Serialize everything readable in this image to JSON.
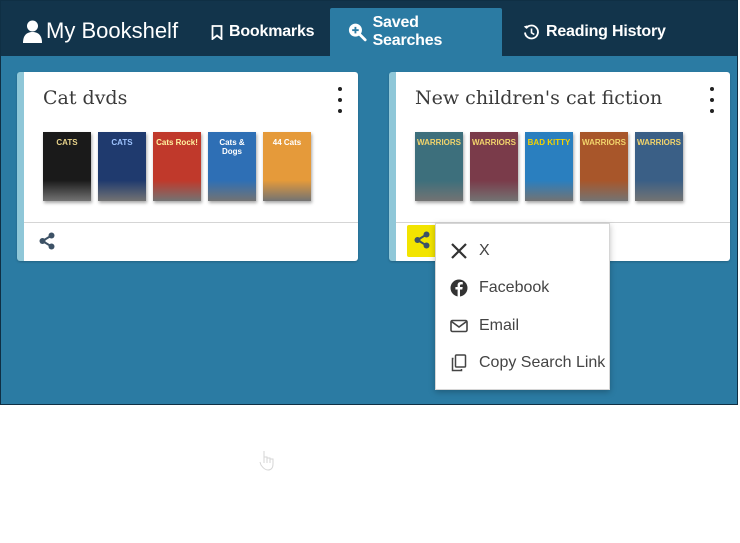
{
  "brand": {
    "title": "My Bookshelf",
    "icon": "user-icon"
  },
  "tabs": [
    {
      "label": "Bookmarks",
      "icon": "bookmark-icon",
      "active": false
    },
    {
      "label": "Saved Searches",
      "icon": "search-plus-icon",
      "active": true
    },
    {
      "label": "Reading History",
      "icon": "history-icon",
      "active": false
    }
  ],
  "cards": [
    {
      "title": "Cat dvds",
      "covers": [
        {
          "text": "CATS",
          "bg": "#1a1a1a",
          "fg": "#e8d38a"
        },
        {
          "text": "CATS",
          "bg": "#1f3a6e",
          "fg": "#9fc4ff"
        },
        {
          "text": "Cats Rock!",
          "bg": "#c0392b",
          "fg": "#fff3a0"
        },
        {
          "text": "Cats & Dogs",
          "bg": "#2e6fb5",
          "fg": "#ffffff"
        },
        {
          "text": "44 Cats",
          "bg": "#e59a3a",
          "fg": "#ffffff"
        }
      ]
    },
    {
      "title": "New children's cat fiction",
      "covers": [
        {
          "text": "WARRIORS",
          "bg": "#3d6f7c",
          "fg": "#f2d46b"
        },
        {
          "text": "WARRIORS",
          "bg": "#7a3b4a",
          "fg": "#f2d46b"
        },
        {
          "text": "BAD KITTY",
          "bg": "#2a7fbf",
          "fg": "#f5d300"
        },
        {
          "text": "WARRIORS",
          "bg": "#a8562a",
          "fg": "#f2d46b"
        },
        {
          "text": "WARRIORS",
          "bg": "#3a5f86",
          "fg": "#f2d46b"
        }
      ]
    }
  ],
  "share_menu": {
    "items": [
      {
        "label": "X",
        "icon": "x-logo-icon"
      },
      {
        "label": "Facebook",
        "icon": "facebook-icon"
      },
      {
        "label": "Email",
        "icon": "email-icon"
      },
      {
        "label": "Copy Search Link",
        "icon": "copy-icon"
      }
    ]
  },
  "colors": {
    "topbar": "#12344b",
    "accent": "#2b7ba3",
    "highlight": "#f2e400"
  }
}
